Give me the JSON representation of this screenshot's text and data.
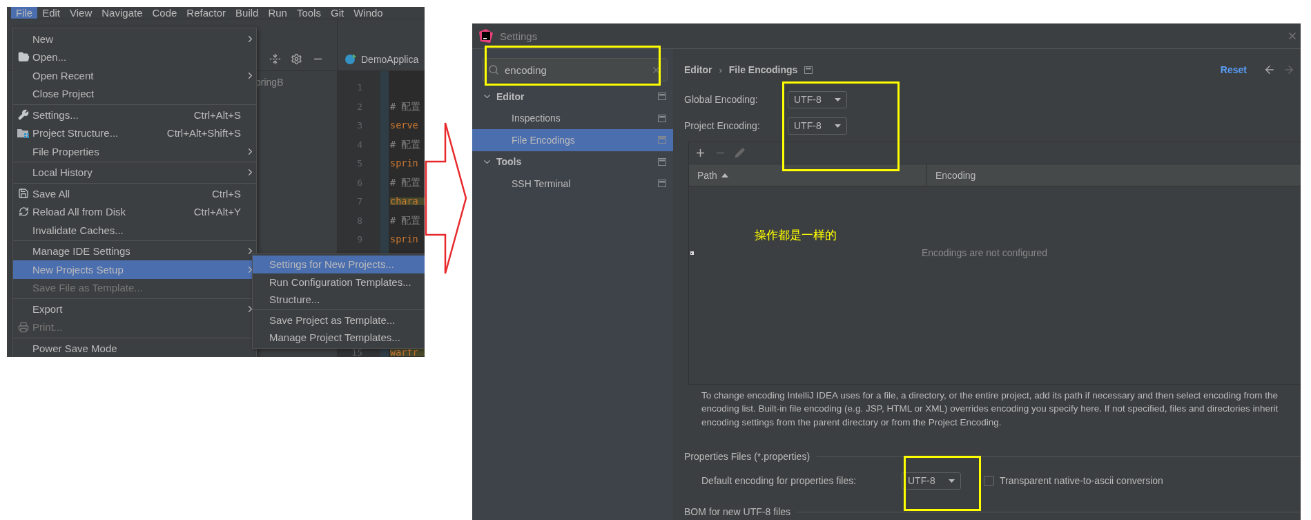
{
  "ide": {
    "menubar": [
      {
        "label": "File",
        "selected": true
      },
      {
        "label": "Edit",
        "selected": false
      },
      {
        "label": "View",
        "selected": false
      },
      {
        "label": "Navigate",
        "selected": false
      },
      {
        "label": "Code",
        "selected": false
      },
      {
        "label": "Refactor",
        "selected": false
      },
      {
        "label": "Build",
        "selected": false
      },
      {
        "label": "Run",
        "selected": false
      },
      {
        "label": "Tools",
        "selected": false
      },
      {
        "label": "Git",
        "selected": false
      },
      {
        "label": "Windo",
        "selected": false
      }
    ],
    "file_menu": {
      "groups": [
        [
          {
            "label": "New",
            "submenu": true,
            "selected": false,
            "disabled": false
          },
          {
            "label": "Open...",
            "submenu": false,
            "selected": false,
            "disabled": false
          },
          {
            "label": "Open Recent",
            "submenu": true,
            "selected": false,
            "disabled": false
          },
          {
            "label": "Close Project",
            "submenu": false,
            "selected": false,
            "disabled": false
          }
        ],
        [
          {
            "label": "Settings...",
            "shortcut": "Ctrl+Alt+S",
            "submenu": false,
            "selected": false,
            "disabled": false
          },
          {
            "label": "Project Structure...",
            "shortcut": "Ctrl+Alt+Shift+S",
            "submenu": false,
            "selected": false,
            "disabled": false
          },
          {
            "label": "File Properties",
            "submenu": true,
            "selected": false,
            "disabled": false
          }
        ],
        [
          {
            "label": "Local History",
            "submenu": true,
            "selected": false,
            "disabled": false
          }
        ],
        [
          {
            "label": "Save All",
            "shortcut": "Ctrl+S",
            "submenu": false,
            "selected": false,
            "disabled": false
          },
          {
            "label": "Reload All from Disk",
            "shortcut": "Ctrl+Alt+Y",
            "submenu": false,
            "selected": false,
            "disabled": false
          },
          {
            "label": "Invalidate Caches...",
            "submenu": false,
            "selected": false,
            "disabled": false
          }
        ],
        [
          {
            "label": "Manage IDE Settings",
            "submenu": true,
            "selected": false,
            "disabled": false
          },
          {
            "label": "New Projects Setup",
            "submenu": true,
            "selected": true,
            "disabled": false
          },
          {
            "label": "Save File as Template...",
            "submenu": false,
            "selected": false,
            "disabled": true
          }
        ],
        [
          {
            "label": "Export",
            "submenu": true,
            "selected": false,
            "disabled": false
          },
          {
            "label": "Print...",
            "submenu": false,
            "selected": false,
            "disabled": true
          }
        ],
        [
          {
            "label": "Power Save Mode",
            "submenu": false,
            "selected": false,
            "disabled": false
          }
        ]
      ]
    },
    "submenu": {
      "groups": [
        [
          {
            "label": "Settings for New Projects...",
            "selected": true
          },
          {
            "label": "Run Configuration Templates...",
            "selected": false
          },
          {
            "label": "Structure...",
            "selected": false
          }
        ],
        [
          {
            "label": "Save Project as Template...",
            "selected": false
          },
          {
            "label": "Manage Project Templates...",
            "selected": false
          }
        ]
      ]
    },
    "project_pane_text": "pringB",
    "editor_tab": "DemoApplica",
    "editor_lines": [
      {
        "number": "1"
      },
      {
        "number": "2",
        "code": "# 配置",
        "kind": "comment",
        "highlighted": false
      },
      {
        "number": "3",
        "code": "serve",
        "kind": "key",
        "highlighted": false
      },
      {
        "number": "4",
        "code": "# 配置",
        "kind": "comment",
        "highlighted": false
      },
      {
        "number": "5",
        "code": "sprin",
        "kind": "key",
        "highlighted": false
      },
      {
        "number": "6",
        "code": "# 配置",
        "kind": "comment",
        "highlighted": false
      },
      {
        "number": "7",
        "code": "chara",
        "kind": "key",
        "highlighted": true
      },
      {
        "number": "8",
        "code": "# 配置",
        "kind": "comment",
        "highlighted": false
      },
      {
        "number": "9",
        "code": "sprin",
        "kind": "key",
        "highlighted": false
      },
      {
        "number": "15",
        "code": "warfr",
        "kind": "key",
        "highlighted": true
      }
    ]
  },
  "settings": {
    "title": "Settings",
    "search": {
      "value": "encoding"
    },
    "tree": [
      {
        "label": "Editor",
        "expanded": true,
        "selected": false,
        "children": [
          {
            "label": "Inspections",
            "selected": false
          },
          {
            "label": "File Encodings",
            "selected": true
          }
        ]
      },
      {
        "label": "Tools",
        "expanded": true,
        "selected": false,
        "children": [
          {
            "label": "SSH Terminal",
            "selected": false
          }
        ]
      }
    ],
    "breadcrumb": [
      "Editor",
      "File Encodings"
    ],
    "breadcrumb_separator": "›",
    "reset": "Reset",
    "fields": [
      {
        "label": "Global Encoding:",
        "value": "UTF-8"
      },
      {
        "label": "Project Encoding:",
        "value": "UTF-8"
      }
    ],
    "table": {
      "columns": [
        {
          "label": "Path",
          "sorted": true
        },
        {
          "label": "Encoding",
          "sorted": false
        }
      ],
      "empty_text": "Encodings are not configured"
    },
    "help_lines": [
      "To change encoding IntelliJ IDEA uses for a file, a directory, or the entire project, add its path if necessary and then select encoding from the",
      "encoding list. Built-in file encoding (e.g. JSP, HTML or XML) overrides encoding you specify here. If not specified, files and directories inherit",
      "encoding settings from the parent directory or from the Project Encoding."
    ],
    "properties": {
      "title": "Properties Files (*.properties)",
      "label": "Default encoding for properties files:",
      "value": "UTF-8",
      "checkbox": {
        "label": "Transparent native-to-ascii conversion",
        "checked": false
      }
    },
    "bom_title": "BOM for new UTF-8 files"
  },
  "annotation": "操作都是一样的"
}
